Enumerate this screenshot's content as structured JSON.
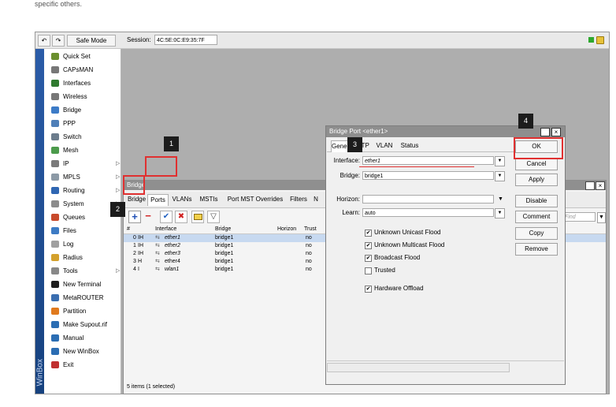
{
  "page_top_text": "specific others.",
  "toolbar": {
    "undo_label": "↶",
    "redo_label": "↷",
    "safe_mode_label": "Safe Mode",
    "session_label": "Session:",
    "session_value": "4C:5E:0C:E9:35:7F"
  },
  "sidebar": {
    "vertical_label": "WinBox",
    "items": [
      {
        "label": "Quick Set",
        "icon_color": "#6a8f2e"
      },
      {
        "label": "CAPsMAN",
        "icon_color": "#777777"
      },
      {
        "label": "Interfaces",
        "icon_color": "#2f7a2f"
      },
      {
        "label": "Wireless",
        "icon_color": "#777777"
      },
      {
        "label": "Bridge",
        "icon_color": "#3c7bc7"
      },
      {
        "label": "PPP",
        "icon_color": "#4f7fb8"
      },
      {
        "label": "Switch",
        "icon_color": "#6c7c8c"
      },
      {
        "label": "Mesh",
        "icon_color": "#4c9b4c"
      },
      {
        "label": "IP",
        "icon_color": "#7a7a7a",
        "arrow": "▷"
      },
      {
        "label": "MPLS",
        "icon_color": "#8c9aa6",
        "arrow": "▷"
      },
      {
        "label": "Routing",
        "icon_color": "#2f66b2",
        "arrow": "▷"
      },
      {
        "label": "System",
        "icon_color": "#8c8c8c",
        "arrow": "▷"
      },
      {
        "label": "Queues",
        "icon_color": "#c84a2c"
      },
      {
        "label": "Files",
        "icon_color": "#3d7bc4"
      },
      {
        "label": "Log",
        "icon_color": "#a0a0a0"
      },
      {
        "label": "Radius",
        "icon_color": "#d4a12c"
      },
      {
        "label": "Tools",
        "icon_color": "#888888",
        "arrow": "▷"
      },
      {
        "label": "New Terminal",
        "icon_color": "#1e1e1e"
      },
      {
        "label": "MetaROUTER",
        "icon_color": "#3a6eb0"
      },
      {
        "label": "Partition",
        "icon_color": "#e07a1e"
      },
      {
        "label": "Make Supout.rif",
        "icon_color": "#2b6db3"
      },
      {
        "label": "Manual",
        "icon_color": "#2b6db3"
      },
      {
        "label": "New WinBox",
        "icon_color": "#2b6db3"
      },
      {
        "label": "Exit",
        "icon_color": "#c03030"
      }
    ]
  },
  "bridge_window": {
    "title": "Bridge",
    "tabs": [
      "Bridge",
      "Ports",
      "VLANs",
      "MSTIs",
      "Port MST Overrides",
      "Filters",
      "N"
    ],
    "active_tab": "Ports",
    "find_placeholder": "Find",
    "columns": [
      "#",
      "Interface",
      "Bridge",
      "Horizon",
      "Trust"
    ],
    "rows": [
      {
        "num": "0",
        "flags": "IH",
        "interface": "ether1",
        "bridge": "bridge1",
        "trust": "no",
        "selected": true
      },
      {
        "num": "1",
        "flags": "IH",
        "interface": "ether2",
        "bridge": "bridge1",
        "trust": "no"
      },
      {
        "num": "2",
        "flags": "IH",
        "interface": "ether3",
        "bridge": "bridge1",
        "trust": "no"
      },
      {
        "num": "3",
        "flags": "H",
        "interface": "ether4",
        "bridge": "bridge1",
        "trust": "no"
      },
      {
        "num": "4",
        "flags": "I",
        "interface": "wlan1",
        "bridge": "bridge1",
        "trust": "no"
      }
    ],
    "status": "5 items (1 selected)"
  },
  "port_dialog": {
    "title": "Bridge Port <ether1>",
    "tabs": [
      "General",
      "STP",
      "VLAN",
      "Status"
    ],
    "labels": {
      "interface": "Interface:",
      "bridge": "Bridge:",
      "horizon": "Horizon:",
      "learn": "Learn:"
    },
    "values": {
      "interface": "ether1",
      "bridge": "bridge1",
      "learn": "auto"
    },
    "checkboxes": [
      {
        "label": "Unknown Unicast Flood",
        "checked": true
      },
      {
        "label": "Unknown Multicast Flood",
        "checked": true
      },
      {
        "label": "Broadcast Flood",
        "checked": true
      },
      {
        "label": "Trusted",
        "checked": false
      },
      {
        "label": "Hardware Offload",
        "checked": true
      }
    ],
    "buttons": [
      "OK",
      "Cancel",
      "Apply",
      "Disable",
      "Comment",
      "Copy",
      "Remove"
    ]
  },
  "annotations": [
    "1",
    "2",
    "3",
    "4"
  ],
  "colors": {
    "highlight_red": "#e03030",
    "selected_row": "#c7d9f0"
  }
}
